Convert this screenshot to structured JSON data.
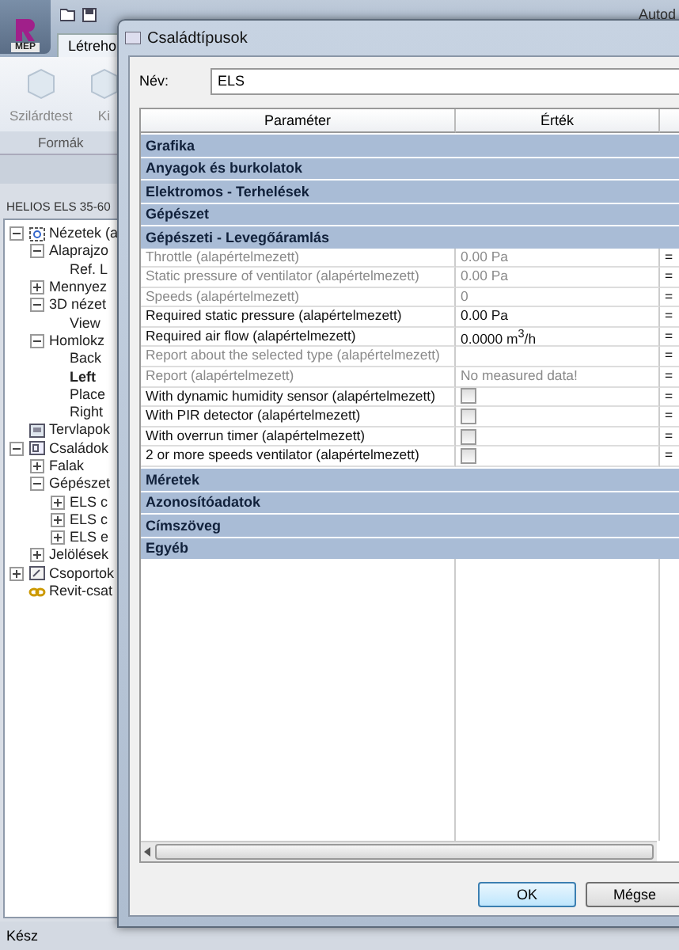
{
  "app": {
    "logo_badge": "MEP",
    "title": "Autod",
    "tab": "Létreho",
    "ribbon_tools": [
      {
        "label": "Szilárdtest",
        "kind": "solid"
      },
      {
        "label": "Ki",
        "kind": "solid"
      }
    ],
    "ribbon_panel": "Formák"
  },
  "browser": {
    "title": "HELIOS ELS 35-60",
    "tree": [
      {
        "label": "Nézetek (a",
        "kind": "views",
        "expanded": true,
        "selected": false,
        "children": [
          {
            "label": "Alaprajzo",
            "expanded": true,
            "selected": false,
            "children": [
              {
                "label": "Ref. L",
                "selected": false
              }
            ]
          },
          {
            "label": "Mennyez",
            "expanded": false,
            "selected": false
          },
          {
            "label": "3D nézet",
            "expanded": true,
            "selected": false,
            "children": [
              {
                "label": "View",
                "selected": false
              }
            ]
          },
          {
            "label": "Homlokz",
            "expanded": true,
            "selected": false,
            "children": [
              {
                "label": "Back",
                "selected": false
              },
              {
                "label": "Left",
                "selected": true
              },
              {
                "label": "Place",
                "selected": false
              },
              {
                "label": "Right",
                "selected": false
              }
            ]
          }
        ]
      },
      {
        "label": "Tervlapok",
        "kind": "sheets",
        "selected": false
      },
      {
        "label": "Családok",
        "kind": "families",
        "expanded": true,
        "selected": false,
        "children": [
          {
            "label": "Falak",
            "expanded": false,
            "selected": false
          },
          {
            "label": "Gépészet",
            "expanded": true,
            "selected": false,
            "children": [
              {
                "label": "ELS c",
                "expanded": false,
                "selected": false
              },
              {
                "label": "ELS c",
                "expanded": false,
                "selected": false
              },
              {
                "label": "ELS e",
                "expanded": false,
                "selected": false
              }
            ]
          },
          {
            "label": "Jelölések",
            "expanded": false,
            "selected": false
          }
        ]
      },
      {
        "label": "Csoportok",
        "kind": "groups",
        "expanded": false,
        "selected": false
      },
      {
        "label": "Revit-csat",
        "kind": "links",
        "selected": false
      }
    ]
  },
  "status_bar": "Kész",
  "dialog": {
    "title": "Családtípusok",
    "name_label": "Név:",
    "name_value": "ELS",
    "table": {
      "columns": [
        "Paraméter",
        "Érték",
        ""
      ],
      "rows": [
        {
          "kind": "group",
          "label": "Grafika"
        },
        {
          "kind": "group",
          "label": "Anyagok és burkolatok"
        },
        {
          "kind": "group",
          "label": "Elektromos - Terhelések"
        },
        {
          "kind": "group",
          "label": "Gépészet"
        },
        {
          "kind": "group",
          "label": "Gépészeti - Levegőáramlás"
        },
        {
          "kind": "text",
          "label": "Throttle (alapértelmezett)",
          "value": "0.00 Pa",
          "formula": "=",
          "disabled": true
        },
        {
          "kind": "text",
          "label": "Static pressure of ventilator (alapértelmezett)",
          "value": "0.00 Pa",
          "formula": "=",
          "disabled": true
        },
        {
          "kind": "text",
          "label": "Speeds (alapértelmezett)",
          "value": "0",
          "formula": "=",
          "disabled": true
        },
        {
          "kind": "text",
          "label": "Required static pressure (alapértelmezett)",
          "value": "0.00 Pa",
          "formula": "=",
          "disabled": false
        },
        {
          "kind": "text",
          "label": "Required air flow (alapértelmezett)",
          "value": "0.0000 m$^{3}$/h",
          "formula": "=",
          "disabled": false
        },
        {
          "kind": "text",
          "label": "Report about the selected type (alapértelmezett)",
          "formula": "=",
          "disabled": true
        },
        {
          "kind": "text",
          "label": "Report (alapértelmezett)",
          "value": "No measured data!",
          "formula": "=",
          "disabled": true
        },
        {
          "kind": "checkbox",
          "label": "With dynamic humidity sensor (alapértelmezett)",
          "checked": false,
          "formula": "=",
          "disabled": false
        },
        {
          "kind": "checkbox",
          "label": "With PIR detector (alapértelmezett)",
          "checked": false,
          "formula": "=",
          "disabled": false
        },
        {
          "kind": "checkbox",
          "label": "With overrun timer (alapértelmezett)",
          "checked": false,
          "formula": "=",
          "disabled": false
        },
        {
          "kind": "checkbox",
          "label": "2 or more speeds ventilator (alapértelmezett)",
          "checked": false,
          "formula": "=",
          "disabled": false
        },
        {
          "kind": "group",
          "label": "Méretek"
        },
        {
          "kind": "group",
          "label": "Azonosítóadatok"
        },
        {
          "kind": "group",
          "label": "Címszöveg"
        },
        {
          "kind": "group",
          "label": "Egyéb"
        }
      ]
    },
    "buttons": [
      {
        "label": "OK",
        "default": true
      },
      {
        "label": "Mégse",
        "default": false
      }
    ]
  }
}
